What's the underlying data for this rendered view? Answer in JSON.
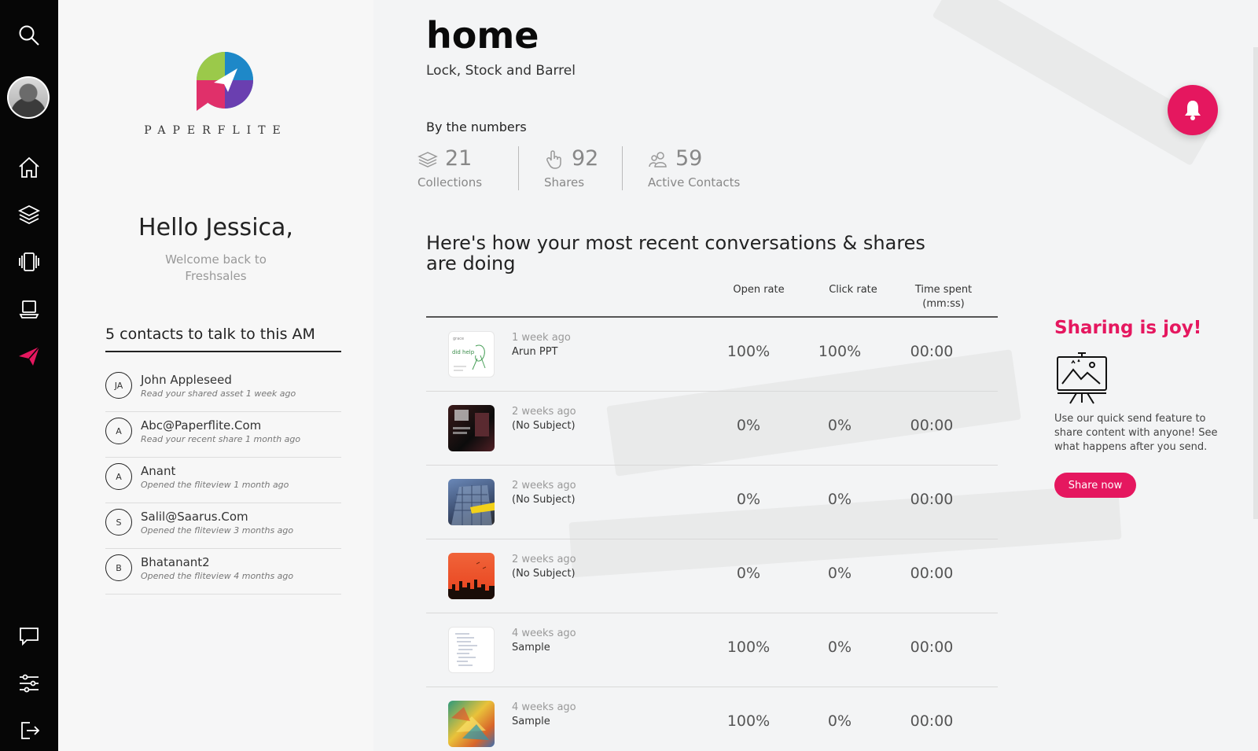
{
  "sidebar": {
    "icons": [
      "search-icon",
      "home-icon",
      "layers-icon",
      "carousel-icon",
      "laptop-icon",
      "send-icon",
      "chat-icon",
      "sliders-icon",
      "logout-icon"
    ],
    "active": "send-icon",
    "accent": "#e5175f"
  },
  "welcome": {
    "brand": "PAPERFLITE",
    "greeting": "Hello Jessica,",
    "subtitle": "Welcome back to Freshsales",
    "contacts_title": "5 contacts to talk to this AM",
    "contacts": [
      {
        "initials": "JA",
        "name": "John Appleseed",
        "note": "Read your shared asset 1 week ago"
      },
      {
        "initials": "A",
        "name": "Abc@Paperflite.Com",
        "note": "Read your recent share 1 month ago"
      },
      {
        "initials": "A",
        "name": "Anant",
        "note": "Opened the fliteview 1 month ago"
      },
      {
        "initials": "S",
        "name": "Salil@Saarus.Com",
        "note": "Opened the fliteview 3 months ago"
      },
      {
        "initials": "B",
        "name": "Bhatanant2",
        "note": "Opened the fliteview 4 months ago"
      }
    ]
  },
  "main": {
    "title": "home",
    "subtitle": "Lock, Stock and Barrel",
    "numbers_heading": "By the numbers",
    "stats": [
      {
        "icon": "layers-icon",
        "value": "21",
        "label": "Collections"
      },
      {
        "icon": "hand-pointer-icon",
        "value": "92",
        "label": "Shares"
      },
      {
        "icon": "contacts-icon",
        "value": "59",
        "label": "Active Contacts"
      }
    ],
    "recent_heading": "Here's how your most recent conversations & shares are doing",
    "columns": {
      "open": "Open rate",
      "click": "Click rate",
      "time": "Time spent (mm:ss)"
    },
    "rows": [
      {
        "time": "1 week ago",
        "title": "Arun PPT",
        "open": "100%",
        "click": "100%",
        "spent": "00:00",
        "thumb": "sketch"
      },
      {
        "time": "2 weeks ago",
        "title": "(No Subject)",
        "open": "0%",
        "click": "0%",
        "spent": "00:00",
        "thumb": "dark"
      },
      {
        "time": "2 weeks ago",
        "title": "(No Subject)",
        "open": "0%",
        "click": "0%",
        "spent": "00:00",
        "thumb": "building"
      },
      {
        "time": "2 weeks ago",
        "title": "(No Subject)",
        "open": "0%",
        "click": "0%",
        "spent": "00:00",
        "thumb": "orange"
      },
      {
        "time": "4 weeks ago",
        "title": "Sample",
        "open": "100%",
        "click": "0%",
        "spent": "00:00",
        "thumb": "doc"
      },
      {
        "time": "4 weeks ago",
        "title": "Sample",
        "open": "100%",
        "click": "0%",
        "spent": "00:00",
        "thumb": "colorful"
      }
    ]
  },
  "promo": {
    "title": "Sharing is joy!",
    "text": "Use our quick send feature to share content with anyone! See what happens after you send.",
    "button": "Share now"
  }
}
